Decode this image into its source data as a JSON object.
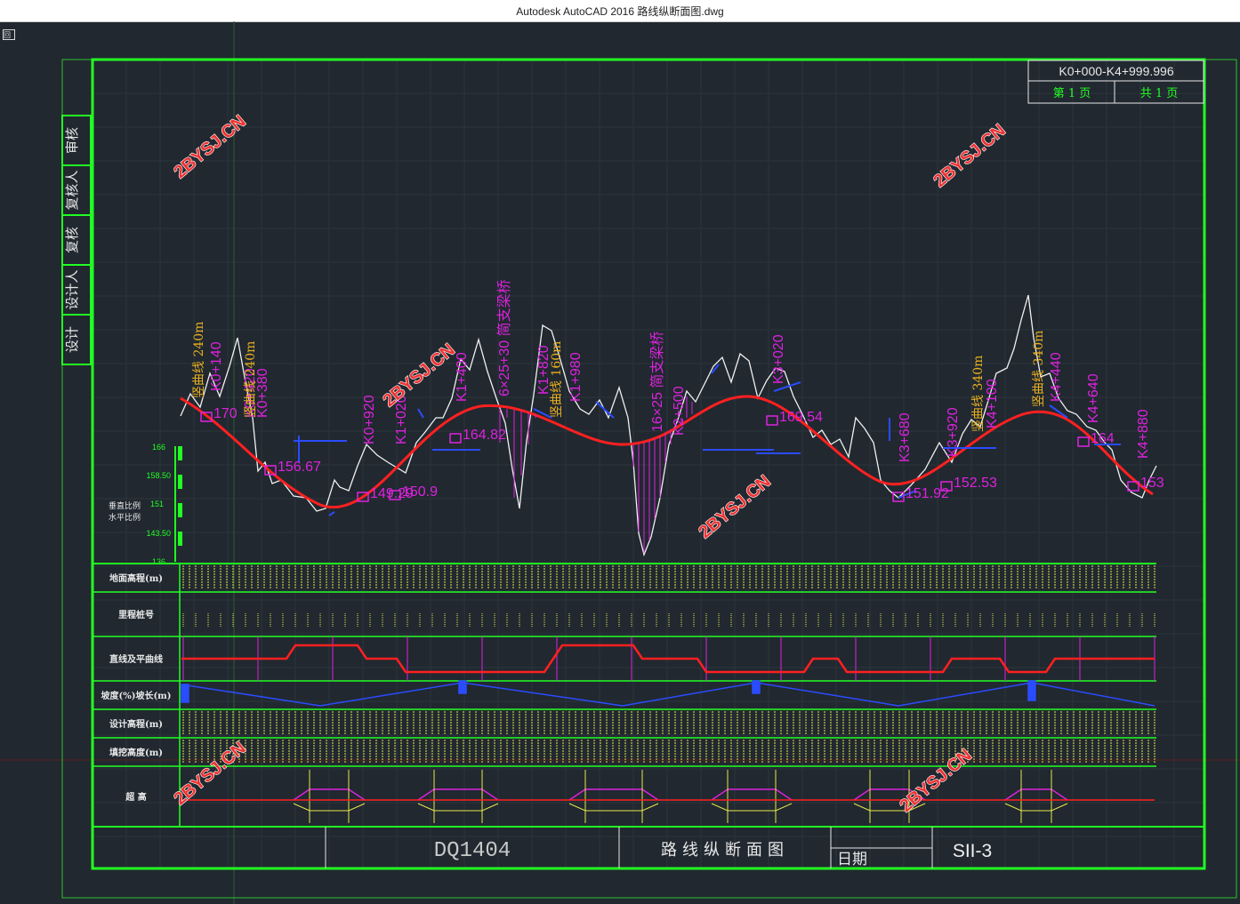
{
  "window": {
    "title": "Autodesk AutoCAD 2016     路线纵断面图.dwg"
  },
  "title_block": {
    "range": "K0+000-K4+999.996",
    "page_label": "第 1 页",
    "total_label": "共 1 页",
    "side_labels": [
      "审核",
      "复核人",
      "复核",
      "设计人",
      "设计"
    ],
    "drawing_no": "DQ1404",
    "drawing_title": "路线纵断面图",
    "date_label": "日期",
    "sheet_id": "SII-3"
  },
  "scale": {
    "vertical_label": "垂直比例",
    "horizontal_label": "水平比例",
    "ticks": [
      "166",
      "158.50",
      "151",
      "143.50",
      "136"
    ]
  },
  "table_rows": [
    "地面高程(m)",
    "里程桩号",
    "直线及平曲线",
    "坡度(%)坡长(m)",
    "设计高程(m)",
    "填挖高度(m)",
    "超  高"
  ],
  "watermark": "2BYSJ.CN",
  "profile_labels": {
    "elevations": [
      "170",
      "156.67",
      "149.29",
      "150.9",
      "164.82",
      "169.54",
      "151.92",
      "152.53",
      "164",
      "153"
    ],
    "stations_magenta": [
      "K0+140",
      "K0+380",
      "K0+420",
      "K0+920",
      "K1+020",
      "K1+400",
      "K1+820",
      "K1+980",
      "K2+500",
      "K3+020",
      "K3+680",
      "K3+920",
      "K4+440",
      "K4+640",
      "K4+880",
      "K4+100"
    ],
    "curve_notes": [
      "竖曲线 240m",
      "竖曲线 240m",
      "竖曲线 160m",
      "竖曲线 340m",
      "竖曲线 340m"
    ],
    "bridges": [
      "6×25+30 简支梁桥",
      "16×25 简支梁桥"
    ]
  }
}
